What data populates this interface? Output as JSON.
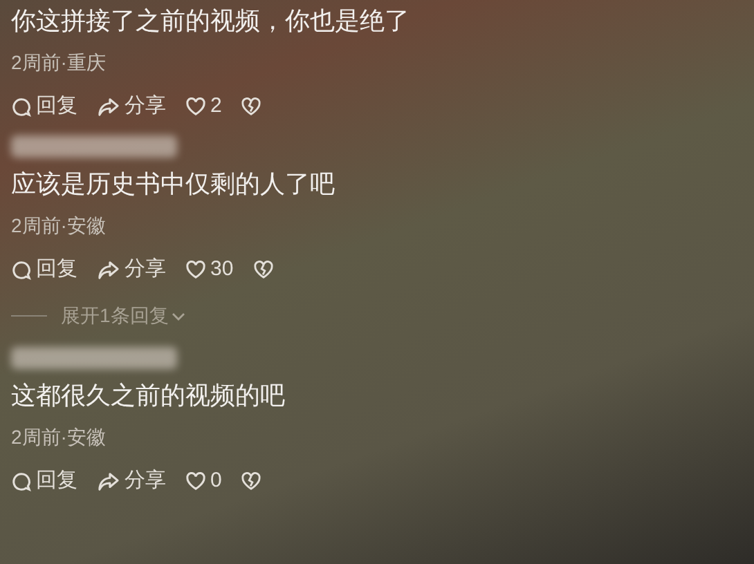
{
  "comments": [
    {
      "name_blurred": false,
      "text": "你这拼接了之前的视频，你也是绝了",
      "meta": "2周前·重庆",
      "reply": "回复",
      "share": "分享",
      "likes": "2"
    },
    {
      "name_blurred": true,
      "text": "应该是历史书中仅剩的人了吧",
      "meta": "2周前·安徽",
      "reply": "回复",
      "share": "分享",
      "likes": "30",
      "replies_toggle": "展开1条回复"
    },
    {
      "name_blurred": true,
      "text": "这都很久之前的视频的吧",
      "meta": "2周前·安徽",
      "reply": "回复",
      "share": "分享",
      "likes": "0"
    }
  ]
}
